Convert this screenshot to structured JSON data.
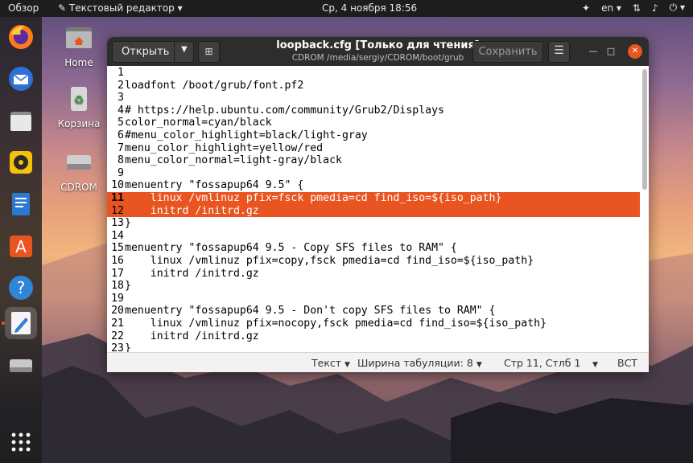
{
  "topbar": {
    "activities": "Обзор",
    "app_name": "Текстовый редактор",
    "clock": "Ср, 4 ноября  18:56",
    "language": "en"
  },
  "dock": {
    "items": [
      "firefox-icon",
      "thunderbird-icon",
      "files-icon",
      "rhythmbox-icon",
      "libreoffice-writer-icon",
      "software-center-icon",
      "help-icon",
      "text-editor-icon",
      "drive-icon",
      "show-applications-icon"
    ]
  },
  "desktop": {
    "icons": [
      {
        "label": "Home"
      },
      {
        "label": "Корзина"
      },
      {
        "label": "CDROM"
      }
    ]
  },
  "window": {
    "title": "loopback.cfg [Только для чтения]",
    "subtitle": "CDROM /media/sergiy/CDROM/boot/grub",
    "open_label": "Открыть",
    "save_label": "Сохранить"
  },
  "editor": {
    "selected_lines": [
      11,
      12
    ],
    "current_line": 11,
    "lines": [
      {
        "n": "1",
        "text": ""
      },
      {
        "n": "2",
        "text": "loadfont /boot/grub/font.pf2"
      },
      {
        "n": "3",
        "text": ""
      },
      {
        "n": "4",
        "text": "# https://help.ubuntu.com/community/Grub2/Displays"
      },
      {
        "n": "5",
        "text": "color_normal=cyan/black"
      },
      {
        "n": "6",
        "text": "#menu_color_highlight=black/light-gray"
      },
      {
        "n": "7",
        "text": "menu_color_highlight=yellow/red"
      },
      {
        "n": "8",
        "text": "menu_color_normal=light-gray/black"
      },
      {
        "n": "9",
        "text": ""
      },
      {
        "n": "10",
        "text": "menuentry \"fossapup64 9.5\" {"
      },
      {
        "n": "11",
        "text": "    linux /vmlinuz pfix=fsck pmedia=cd find_iso=${iso_path}"
      },
      {
        "n": "12",
        "text": "    initrd /initrd.gz"
      },
      {
        "n": "13",
        "text": "}"
      },
      {
        "n": "14",
        "text": ""
      },
      {
        "n": "15",
        "text": "menuentry \"fossapup64 9.5 - Copy SFS files to RAM\" {"
      },
      {
        "n": "16",
        "text": "    linux /vmlinuz pfix=copy,fsck pmedia=cd find_iso=${iso_path}"
      },
      {
        "n": "17",
        "text": "    initrd /initrd.gz"
      },
      {
        "n": "18",
        "text": "}"
      },
      {
        "n": "19",
        "text": ""
      },
      {
        "n": "20",
        "text": "menuentry \"fossapup64 9.5 - Don't copy SFS files to RAM\" {"
      },
      {
        "n": "21",
        "text": "    linux /vmlinuz pfix=nocopy,fsck pmedia=cd find_iso=${iso_path}"
      },
      {
        "n": "22",
        "text": "    initrd /initrd.gz"
      },
      {
        "n": "23",
        "text": "}"
      }
    ]
  },
  "statusbar": {
    "syntax": "Текст",
    "tab_width": "Ширина табуляции: 8",
    "position": "Стр 11, Стлб 1",
    "mode": "ВСТ"
  },
  "colors": {
    "accent": "#e95420",
    "titlebar": "#2d2d2d"
  }
}
